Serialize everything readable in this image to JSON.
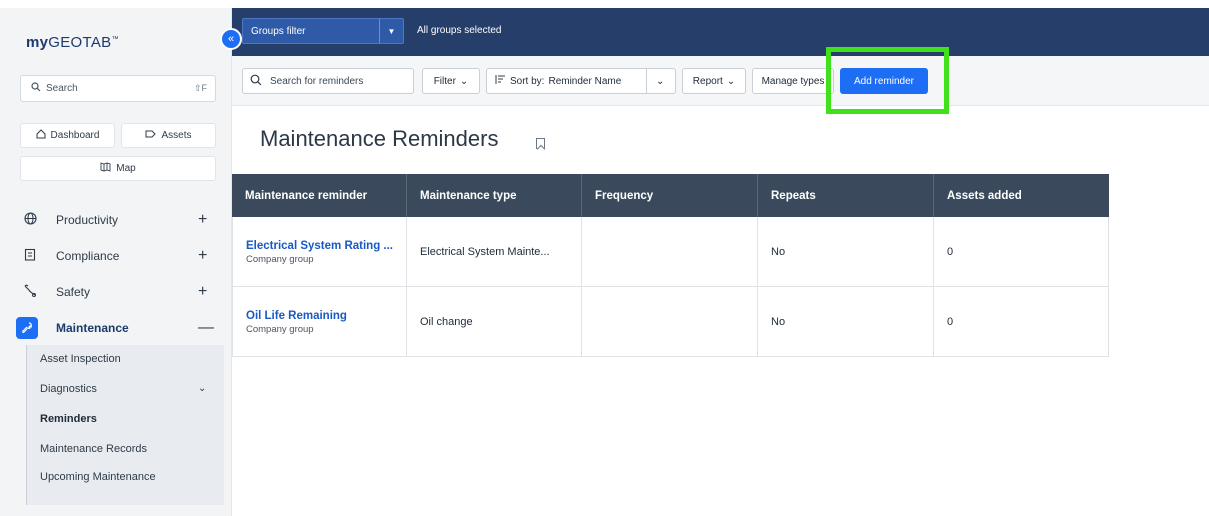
{
  "app": {
    "logo_bold": "my",
    "logo_rest": "GEOTAB",
    "logo_tm": "™"
  },
  "sidebar": {
    "collapse_icon": "«",
    "search_placeholder": "Search",
    "search_shortcut": "⇧F",
    "quick_links": [
      {
        "label": "Dashboard",
        "icon": "home-icon"
      },
      {
        "label": "Assets",
        "icon": "tag-icon"
      },
      {
        "label": "Map",
        "icon": "map-icon"
      }
    ],
    "nav": [
      {
        "label": "Productivity",
        "icon": "globe-icon",
        "toggle": "+"
      },
      {
        "label": "Compliance",
        "icon": "clipboard-icon",
        "toggle": "+"
      },
      {
        "label": "Safety",
        "icon": "safety-icon",
        "toggle": "+"
      },
      {
        "label": "Maintenance",
        "icon": "wrench-icon",
        "toggle": "—"
      }
    ],
    "submenu": [
      {
        "label": "Asset Inspection"
      },
      {
        "label": "Diagnostics",
        "chevron": "⌄"
      },
      {
        "label": "Reminders",
        "active": true
      },
      {
        "label": "Maintenance Records"
      },
      {
        "label": "Upcoming Maintenance"
      }
    ]
  },
  "topbar": {
    "groups_filter_label": "Groups filter",
    "groups_filter_drop": "▼",
    "groups_status": "All groups selected",
    "bg_color": "#253e6a"
  },
  "toolbar": {
    "search_placeholder": "Search for reminders",
    "filter_label": "Filter",
    "sort_prefix": "Sort by:",
    "sort_value": "Reminder Name",
    "report_label": "Report",
    "manage_types_label": "Manage types",
    "add_reminder_label": "Add reminder",
    "chevron": "⌄",
    "accent_color": "#1d6ef5"
  },
  "page": {
    "title": "Maintenance Reminders"
  },
  "table": {
    "columns": [
      "Maintenance reminder",
      "Maintenance type",
      "Frequency",
      "Repeats",
      "Assets added"
    ],
    "rows": [
      {
        "name": "Electrical System Rating ...",
        "group": "Company group",
        "type": "Electrical System Mainte...",
        "frequency": "",
        "repeats": "No",
        "assets": "0"
      },
      {
        "name": "Oil Life Remaining",
        "group": "Company group",
        "type": "Oil change",
        "frequency": "",
        "repeats": "No",
        "assets": "0"
      }
    ]
  }
}
